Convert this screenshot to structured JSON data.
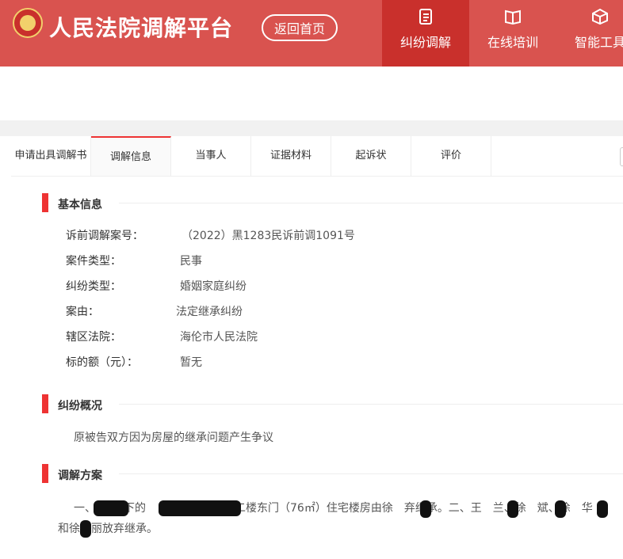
{
  "header": {
    "title": "人民法院调解平台",
    "home_button": "返回首页",
    "nav": [
      {
        "label": "纠纷调解",
        "icon": "document-list-icon"
      },
      {
        "label": "在线培训",
        "icon": "book-icon"
      },
      {
        "label": "智能工具",
        "icon": "cube-icon"
      }
    ]
  },
  "tabs": [
    "申请出具调解书",
    "调解信息",
    "当事人",
    "证据材料",
    "起诉状",
    "评价"
  ],
  "basic": {
    "title": "基本信息",
    "rows": [
      {
        "label": "诉前调解案号：",
        "value": "（2022）黑1283民诉前调1091号"
      },
      {
        "label": "案件类型：",
        "value": "民事"
      },
      {
        "label": "纠纷类型：",
        "value": "婚姻家庭纠纷"
      },
      {
        "label": "案由：",
        "value": "法定继承纠纷"
      },
      {
        "label": "辖区法院：",
        "value": "海伦市人民法院"
      },
      {
        "label": "标的额（元）：",
        "value": "暂无"
      }
    ]
  },
  "overview": {
    "title": "纠纷概况",
    "text": "原被告双方因为房屋的继承问题产生争议"
  },
  "plan": {
    "title": "调解方案",
    "line1": "一、　　名下的　　　　　　单元二楼东门（76㎡）住宅楼房由徐　弃继承。二、王　兰、徐　斌、徐　华",
    "line2": "和徐　丽放弃继承。"
  }
}
